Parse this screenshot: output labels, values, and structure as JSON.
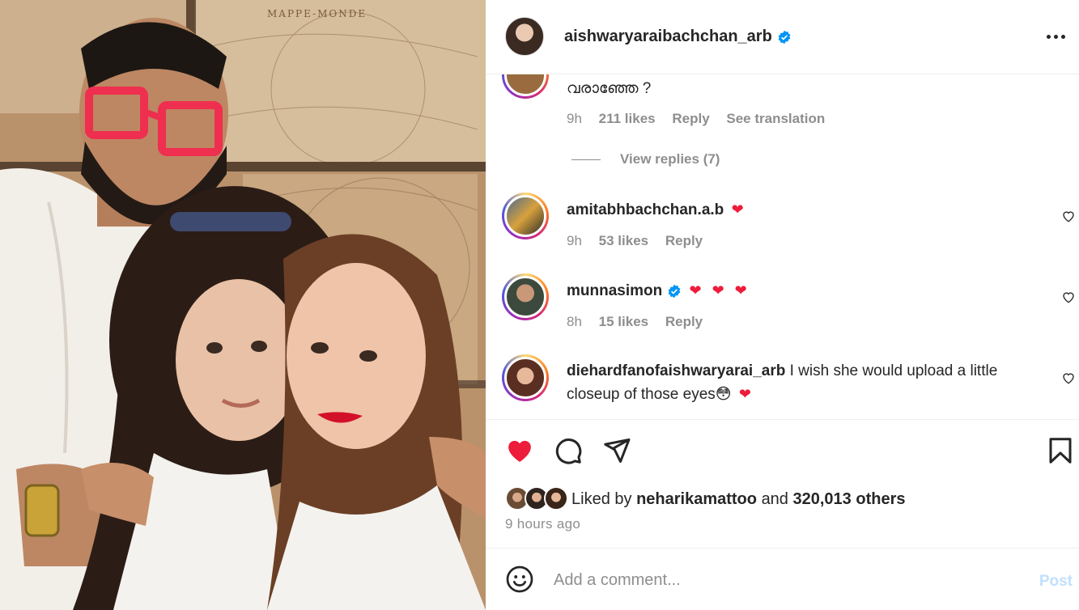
{
  "photo": {
    "map_caption": "MAPPE-MONDE"
  },
  "post": {
    "username": "aishwaryaraibachchan_arb",
    "verified": true
  },
  "comments": [
    {
      "username": "",
      "text": "വരാഞ്ഞേ ?",
      "time": "9h",
      "likes": "211 likes",
      "reply": "Reply",
      "translation": "See translation",
      "view_replies": "View replies (7)"
    },
    {
      "username": "amitabhbachchan.a.b",
      "text": "",
      "hearts": "❤",
      "time": "9h",
      "likes": "53 likes",
      "reply": "Reply"
    },
    {
      "username": "munnasimon",
      "verified": true,
      "text": "",
      "hearts": "❤ ❤ ❤",
      "time": "8h",
      "likes": "15 likes",
      "reply": "Reply"
    },
    {
      "username": "diehardfanofaishwaryarai_arb",
      "text": "I wish she would upload a little closeup of those eyes",
      "emoji": "😳",
      "hearts": "❤"
    }
  ],
  "actions": {
    "liked_by_prefix": "Liked by",
    "liked_by_user": "neharikamattoo",
    "liked_by_and": "and",
    "liked_by_count": "320,013 others",
    "post_time": "9 hours ago"
  },
  "add_comment": {
    "placeholder": "Add a comment...",
    "post_label": "Post"
  },
  "colors": {
    "like_red": "#ed1c3b",
    "verified_blue": "#0095f6",
    "post_button_disabled": "#c0dffd",
    "meta_gray": "#8e8e8e"
  },
  "icons": [
    "more-icon",
    "verified-icon",
    "heart-icon",
    "comment-icon",
    "share-icon",
    "save-icon",
    "emoji-icon",
    "small-heart-icon"
  ]
}
